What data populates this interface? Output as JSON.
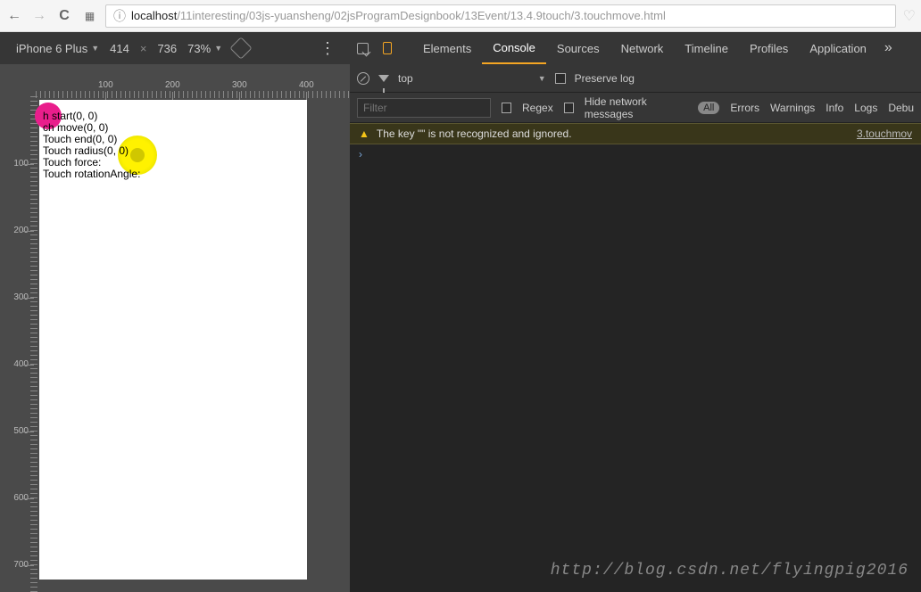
{
  "browser": {
    "url_host": "localhost",
    "url_path": "/11interesting/03js-yuansheng/02jsProgramDesignbook/13Event/13.4.9touch/3.touchmove.html"
  },
  "device": {
    "name": "iPhone 6 Plus",
    "width": "414",
    "x": "×",
    "height": "736",
    "zoom": "73%"
  },
  "devtools": {
    "tabs": [
      "Elements",
      "Console",
      "Sources",
      "Network",
      "Timeline",
      "Profiles",
      "Application"
    ],
    "activeTab": 1
  },
  "consoleToolbar": {
    "context": "top",
    "preserve": "Preserve log"
  },
  "filterRow": {
    "placeholder": "Filter",
    "regex": "Regex",
    "hide": "Hide network messages",
    "all": "All",
    "levels": [
      "Errors",
      "Warnings",
      "Info",
      "Logs",
      "Debu"
    ]
  },
  "warning": {
    "text": "The key \"\" is not recognized and ignored.",
    "link": "3.touchmov"
  },
  "touchOutput": {
    "l1": "    h start(0, 0)",
    "l2": "   ch move(0, 0)",
    "l3": "Touch end(0, 0)",
    "l4": "Touch radius(0, 0)",
    "l5": "Touch force:",
    "l6": "Touch rotationAngle:"
  },
  "rulerH": [
    "100",
    "200",
    "300",
    "400"
  ],
  "rulerV": [
    "100",
    "200",
    "300",
    "400",
    "500",
    "600",
    "700"
  ],
  "watermark": "http://blog.csdn.net/flyingpig2016"
}
